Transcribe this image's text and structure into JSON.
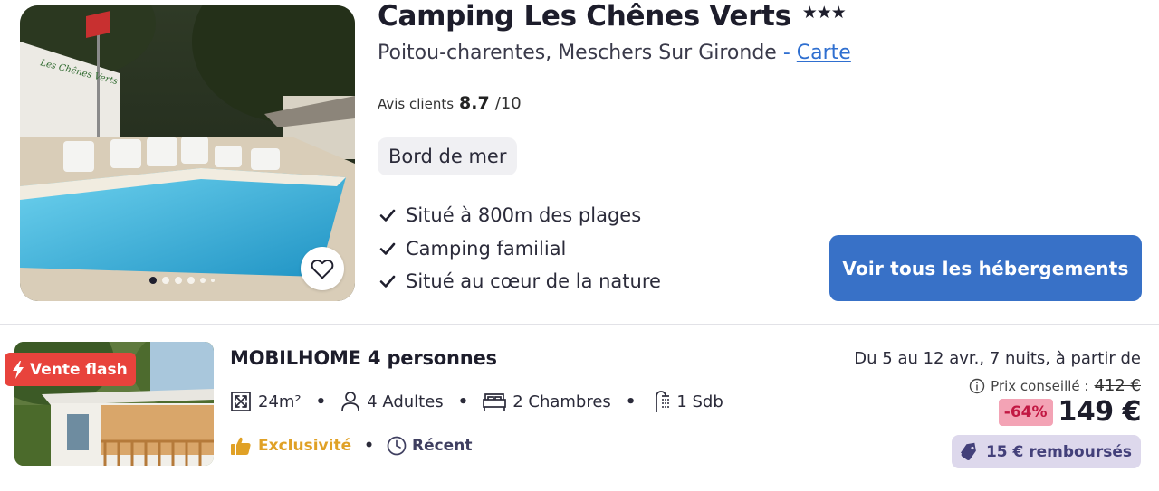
{
  "camping": {
    "name": "Camping Les Chênes Verts",
    "stars": "★★★",
    "region": "Poitou-charentes, Meschers Sur Gironde",
    "separator": "-",
    "map_link": "Carte",
    "rating_label": "Avis clients",
    "rating_value": "8.7",
    "rating_scale": "/10",
    "tag": "Bord de mer",
    "features": [
      "Situé à 800m des plages",
      "Camping familial",
      "Situé au cœur de la nature"
    ],
    "cta_label": "Voir tous les hébergements",
    "gallery_sign": "Les Chênes Verts",
    "gallery_dots": 6
  },
  "offer": {
    "flash_label": "Vente flash",
    "title": "MOBILHOME 4 personnes",
    "area": "24m²",
    "guests": "4 Adultes",
    "bedrooms": "2 Chambres",
    "bathrooms": "1 Sdb",
    "bullet": "•",
    "badge_exclusive": "Exclusivité",
    "badge_recent": "Récent",
    "dates": "Du 5 au 12 avr., 7 nuits, à partir de",
    "advised_label": "Prix conseillé :",
    "advised_price": "412 €",
    "discount": "-64%",
    "price": "149 €",
    "refund": "15 € remboursés"
  },
  "colors": {
    "primary_button": "#3871c7",
    "link": "#2f6fd0",
    "flash": "#e8433c",
    "exclusive": "#e0a126",
    "discount_bg": "#f3a3b5",
    "discount_text": "#c21843",
    "refund_bg": "#ddd8ec"
  },
  "icons": {
    "favorite": "heart-icon",
    "feature": "check-icon",
    "flash": "lightning-icon",
    "area": "expand-icon",
    "guests": "person-icon",
    "bedrooms": "bed-icon",
    "bathrooms": "shower-icon",
    "exclusive": "thumbs-up-icon",
    "recent": "clock-icon",
    "info": "info-icon",
    "refund": "tag-icon"
  }
}
